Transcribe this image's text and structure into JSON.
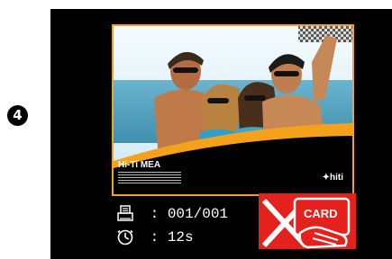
{
  "step": {
    "number": "4"
  },
  "photo": {
    "brand": "Hi-Ti MEA",
    "logo": "hiti"
  },
  "status": {
    "print_count": "001/001",
    "time_remaining": "12s"
  },
  "alert": {
    "card_label": "CARD",
    "colors": {
      "background": "#e4211d",
      "icon": "#ffffff"
    },
    "icon_names": [
      "card-icon",
      "hand-icon",
      "cross-icon"
    ]
  },
  "icons": [
    "printer-icon",
    "timer-icon"
  ],
  "colors": {
    "frame_accent": "#f4a21b",
    "screen_background": "#000000",
    "text": "#ffffff"
  }
}
